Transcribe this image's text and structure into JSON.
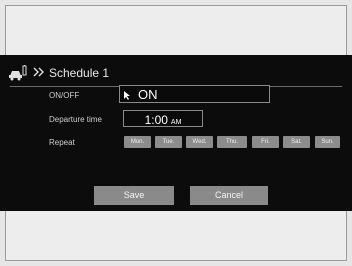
{
  "title": "Schedule 1",
  "rows": {
    "onoff_label": "ON/OFF",
    "onoff_value": "ON",
    "departure_label": "Departure time",
    "departure_time": "1:00",
    "departure_ampm": "AM",
    "repeat_label": "Repeat"
  },
  "days": [
    "Mon.",
    "Tue.",
    "Wed.",
    "Thu.",
    "Fri.",
    "Sat.",
    "Sun."
  ],
  "buttons": {
    "save": "Save",
    "cancel": "Cancel"
  },
  "icons": {
    "title_icon": "vehicle-charging-icon",
    "chevron": "double-chevron-right-icon",
    "cursor": "cursor-icon"
  },
  "colors": {
    "screen_bg": "#0c0c0c",
    "button_bg": "#8a8a8a",
    "page_bg": "#ededed"
  }
}
